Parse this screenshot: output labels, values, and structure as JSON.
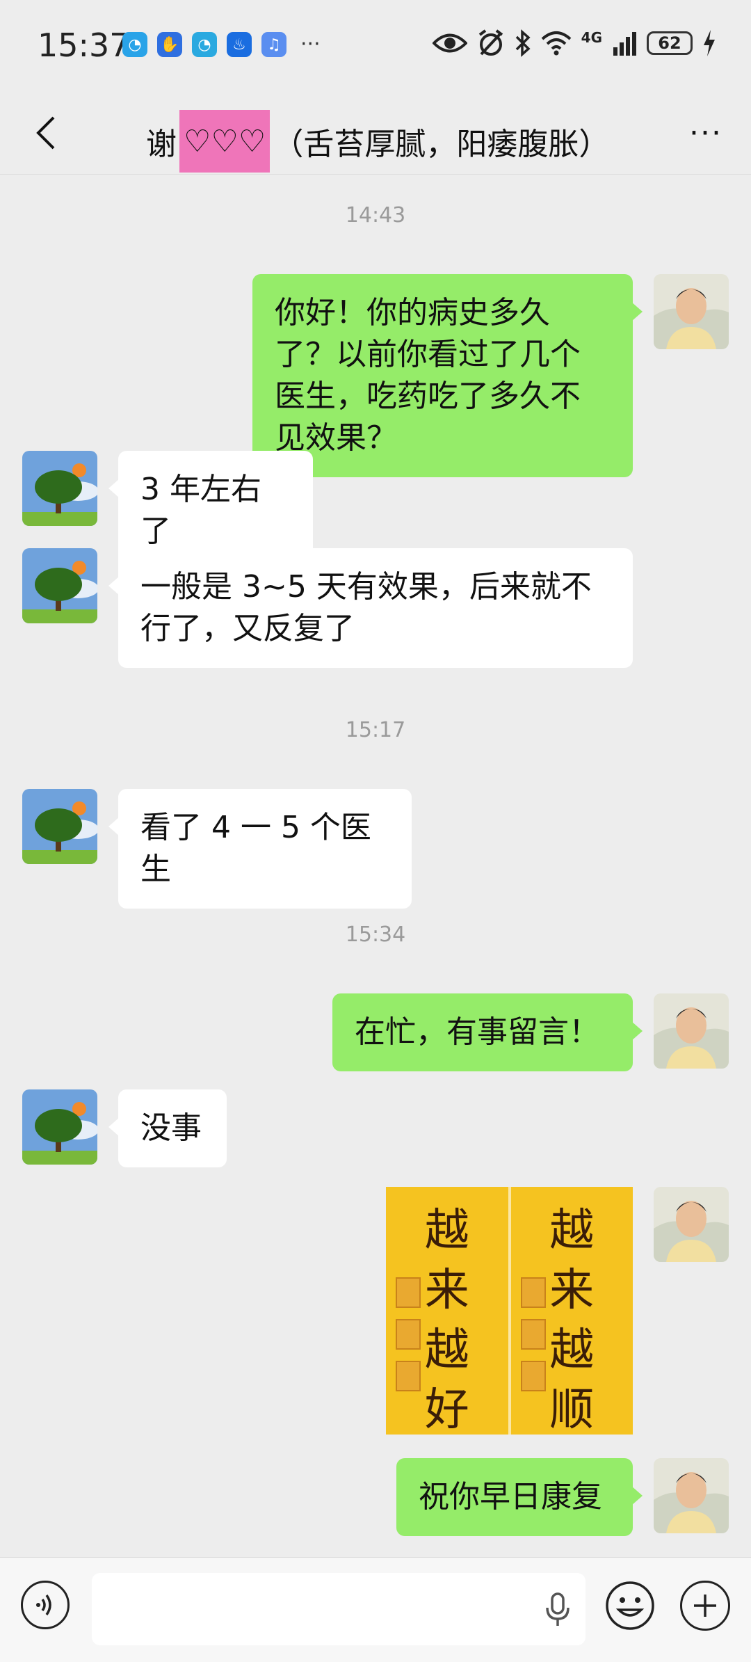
{
  "status_bar": {
    "time": "15:37",
    "more_indicator": "···",
    "network_label": "4G",
    "battery_level": "62",
    "app_icons": [
      "browser-icon",
      "shield-app-icon",
      "browser-icon",
      "bulb-app-icon",
      "music-app-icon"
    ],
    "right_icons": [
      "eye-icon",
      "alarm-off-icon",
      "bluetooth-icon",
      "wifi-icon",
      "signal-icon",
      "battery-icon",
      "charging-icon"
    ]
  },
  "header": {
    "title_prefix": "谢",
    "title_hearts": "♡♡♡",
    "title_suffix": "（舌苔厚腻，阳痿腹胀）",
    "more_label": "···"
  },
  "messages": [
    {
      "type": "timestamp",
      "text": "14:43"
    },
    {
      "type": "text",
      "sender": "me",
      "text": "你好！你的病史多久了？以前你看过了几个医生，吃药吃了多久不见效果？"
    },
    {
      "type": "text",
      "sender": "other",
      "text": "3 年左右了"
    },
    {
      "type": "text",
      "sender": "other",
      "text": "一般是 3~5 天有效果，后来就不行了，又反复了"
    },
    {
      "type": "timestamp",
      "text": "15:17"
    },
    {
      "type": "text",
      "sender": "other",
      "text": "看了 4 一 5 个医生"
    },
    {
      "type": "timestamp",
      "text": "15:34"
    },
    {
      "type": "text",
      "sender": "me",
      "text": "在忙，有事留言！"
    },
    {
      "type": "text",
      "sender": "other",
      "text": "没事"
    },
    {
      "type": "image",
      "sender": "me",
      "left_text": "越来越好",
      "right_text": "越来越顺"
    },
    {
      "type": "text",
      "sender": "me",
      "text": "祝你早日康复"
    }
  ],
  "colors": {
    "background": "#ededed",
    "my_bubble": "#95ec69",
    "other_bubble": "#ffffff",
    "title_highlight": "#ef75b9",
    "image_background": "#f5c320"
  }
}
